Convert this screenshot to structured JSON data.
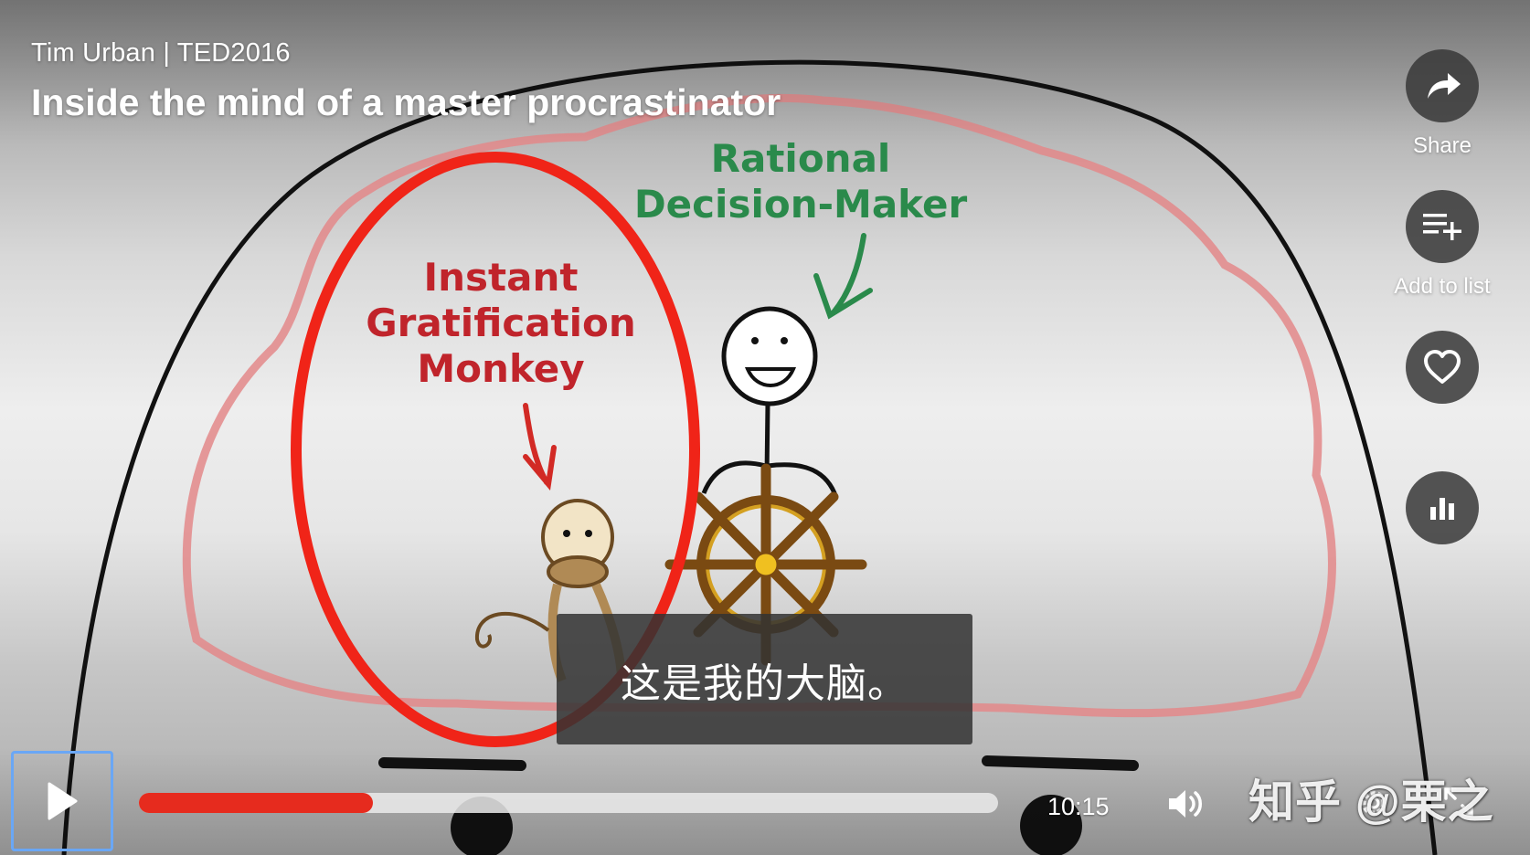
{
  "video": {
    "speaker_event": "Tim Urban | TED2016",
    "title": "Inside the mind of a master procrastinator"
  },
  "sidebar": {
    "share_label": "Share",
    "add_to_list_label": "Add to list",
    "like_label": "",
    "stats_label": ""
  },
  "scene": {
    "rational_line1": "Rational",
    "rational_line2": "Decision-Maker",
    "monkey_line1": "Instant",
    "monkey_line2": "Gratification",
    "monkey_line3": "Monkey"
  },
  "subtitle": {
    "text": "这是我的大脑。"
  },
  "player": {
    "time": "10:15",
    "progress": 0.272
  },
  "watermark": {
    "text": "知乎 @栗之"
  },
  "colors": {
    "accent": "#e62b1e",
    "annotation_red": "#f02418",
    "rational_green": "#2a8a4b",
    "monkey_red": "#c0242b"
  },
  "icons": [
    "share-icon",
    "playlist-add-icon",
    "heart-icon",
    "bar-chart-icon",
    "play-icon",
    "volume-icon",
    "settings-icon",
    "fullscreen-icon"
  ]
}
